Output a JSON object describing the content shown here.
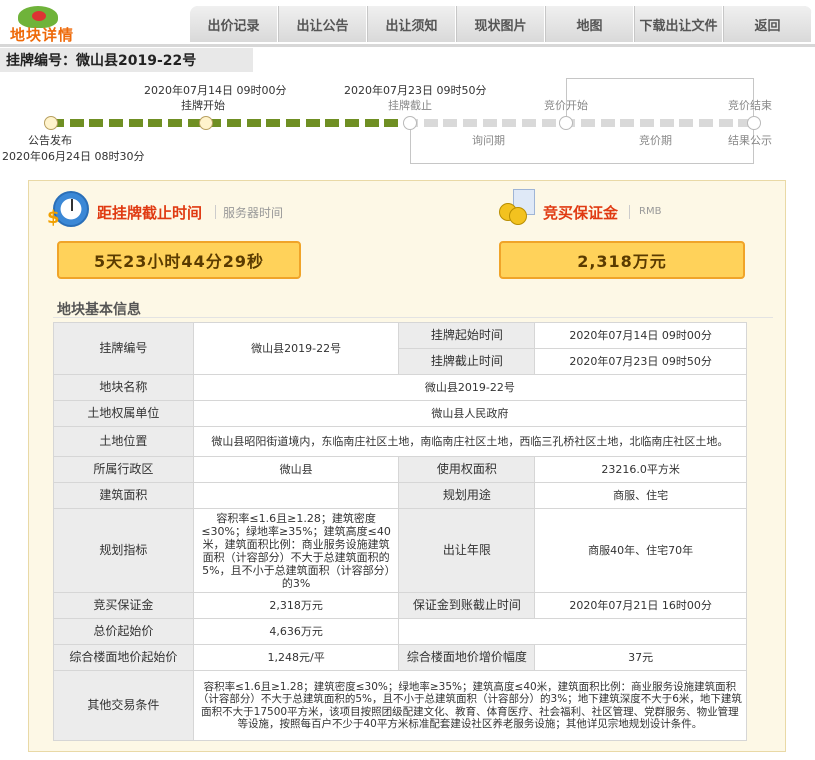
{
  "logo": {
    "text": "地块详情"
  },
  "nav": {
    "items": [
      "出价记录",
      "出让公告",
      "出让须知",
      "现状图片",
      "地图",
      "下载出让文件",
      "返回"
    ]
  },
  "listing_code_label": "挂牌编号：微山县2019-22号",
  "timeline": {
    "announce": {
      "label": "公告发布",
      "time": "2020年06月24日 08时30分"
    },
    "listing_start": {
      "label": "挂牌开始",
      "time": "2020年07月14日 09时00分"
    },
    "listing_end": {
      "label": "挂牌截止",
      "time": "2020年07月23日 09时50分"
    },
    "inquiry": "询问期",
    "bid_start": "竞价开始",
    "bidding": "竞价期",
    "bid_end": "竞价结束",
    "result": "结果公示",
    "progress_segments_done": 18,
    "total_segments": 36
  },
  "countdown": {
    "title": "距挂牌截止时间",
    "sub": "服务器时间",
    "value": "5天23小时44分29秒"
  },
  "deposit": {
    "title": "竞买保证金",
    "sub": "RMB",
    "value": "2,318万元"
  },
  "info": {
    "title": "地块基本信息",
    "rows": {
      "code_h": "挂牌编号",
      "code_v": "微山县2019-22号",
      "start_h": "挂牌起始时间",
      "start_v": "2020年07月14日 09时00分",
      "end_h": "挂牌截止时间",
      "end_v": "2020年07月23日 09时50分",
      "name_h": "地块名称",
      "name_v": "微山县2019-22号",
      "owner_h": "土地权属单位",
      "owner_v": "微山县人民政府",
      "location_h": "土地位置",
      "location_v": "微山县昭阳街道境内，东临南庄社区土地，南临南庄社区土地，西临三孔桥社区土地，北临南庄社区土地。",
      "district_h": "所属行政区",
      "district_v": "微山县",
      "area_h": "使用权面积",
      "area_v": "23216.0平方米",
      "build_h": "建筑面积",
      "build_v": "",
      "use_h": "规划用途",
      "use_v": "商服、住宅",
      "index_h": "规划指标",
      "index_v": "容积率≤1.6且≥1.28；建筑密度≤30%；绿地率≥35%；建筑高度≤40米，建筑面积比例：商业服务设施建筑面积（计容部分）不大于总建筑面积的5%，且不小于总建筑面积（计容部分）的3%",
      "term_h": "出让年限",
      "term_v": "商服40年、住宅70年",
      "deposit_h": "竞买保证金",
      "deposit_v": "2,318万元",
      "deadline_h": "保证金到账截止时间",
      "deadline_v": "2020年07月21日 16时00分",
      "price_h": "总价起始价",
      "price_v": "4,636万元",
      "floor_h": "综合楼面地价起始价",
      "floor_v": "1,248元/平",
      "incr_h": "综合楼面地价增价幅度",
      "incr_v": "37元",
      "other_h": "其他交易条件",
      "other_v": "容积率≤1.6且≥1.28；建筑密度≤30%；绿地率≥35%；建筑高度≤40米，建筑面积比例：商业服务设施建筑面积（计容部分）不大于总建筑面积的5%，且不小于总建筑面积（计容部分）的3%；地下建筑深度不大于6米，地下建筑面积不大于17500平方米，该项目按照团级配建文化、教育、体育医疗、社会福利、社区管理、党群服务、物业管理等设施，按照每百户不少于40平方米标准配套建设社区养老服务设施；其他详见宗地规划设计条件。"
    }
  },
  "colors": {
    "accent": "#e03a12",
    "progress_done": "#6f8f23",
    "progress_todo": "#d9d9d9",
    "box_fill": "#ffd25a",
    "panel_bg": "#fdf8e6"
  }
}
